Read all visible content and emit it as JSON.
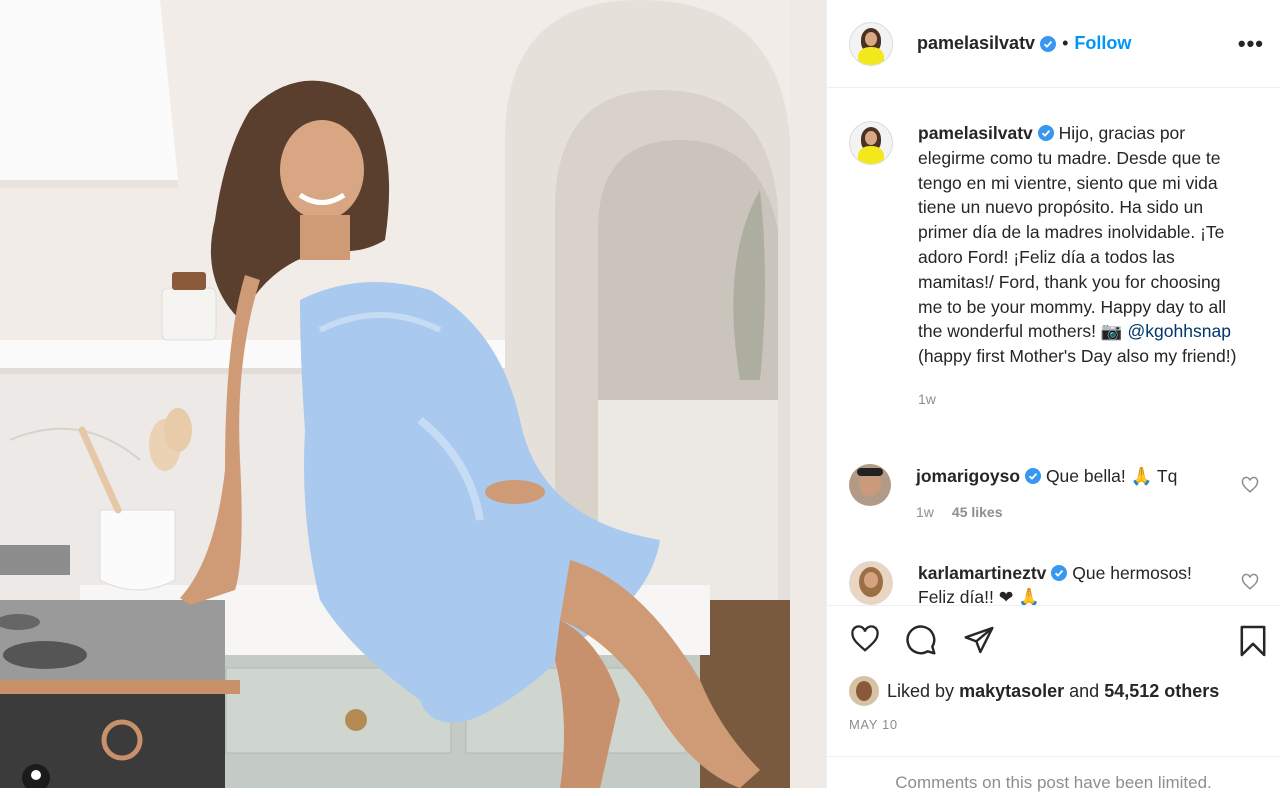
{
  "post": {
    "author": "pamelasilvatv",
    "follow_label": "Follow",
    "dot": "•",
    "more_label": "•••"
  },
  "caption": {
    "username": "pamelasilvatv",
    "text_before": "Hijo, gracias por elegirme como tu madre. Desde que te tengo en mi vientre, siento que mi vida tiene un nuevo propósito. Ha sido un primer día de la madres inolvidable. ¡Te adoro Ford! ¡Feliz día a todos las mamitas!/ Ford, thank you for choosing me to be your mommy. Happy day to all the wonderful mothers! 📷 ",
    "mention": "@kgohhsnap",
    "text_after": " (happy first Mother's Day also my friend!)",
    "time": "1w"
  },
  "comments": [
    {
      "username": "jomarigoyso",
      "text": "Que bella! 🙏 Tq",
      "time": "1w",
      "likes": "45 likes"
    },
    {
      "username": "karlamartineztv",
      "text": "Que hermosos! Feliz día!! ❤ 🙏"
    }
  ],
  "likes": {
    "prefix": "Liked by ",
    "user": "makytasoler",
    "middle": " and ",
    "others": "54,512 others"
  },
  "date": "MAY 10",
  "comments_limited": "Comments on this post have been limited.",
  "colors": {
    "accent": "#0095f6",
    "verified": "#3897f0",
    "dress": "#a9c9ee"
  }
}
